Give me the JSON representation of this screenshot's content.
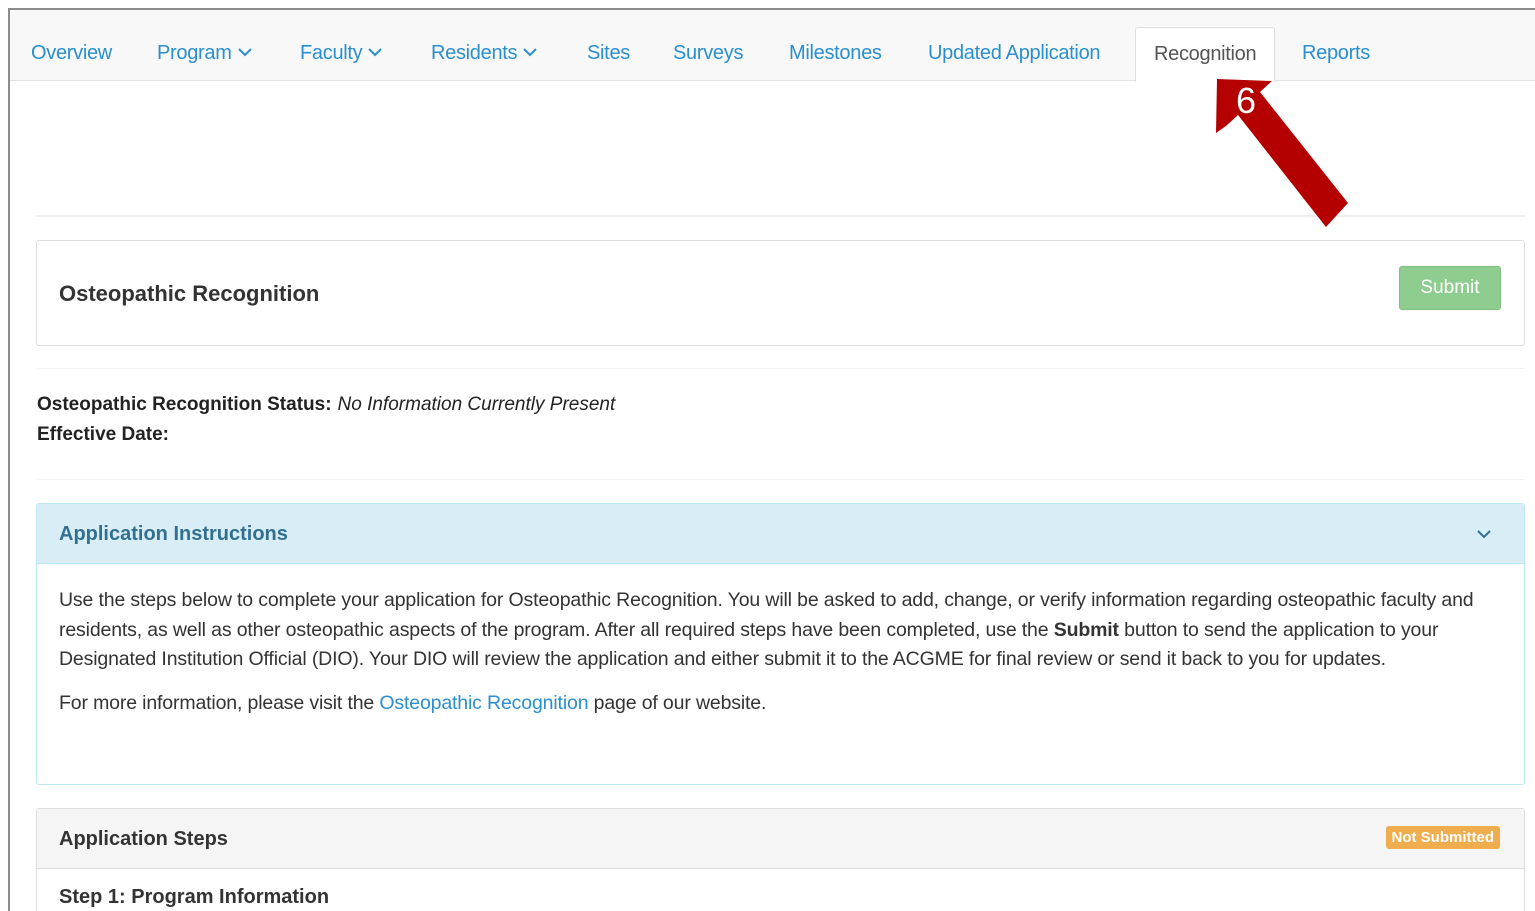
{
  "nav": {
    "items": [
      {
        "label": "Overview",
        "dropdown": false
      },
      {
        "label": "Program",
        "dropdown": true
      },
      {
        "label": "Faculty",
        "dropdown": true
      },
      {
        "label": "Residents",
        "dropdown": true
      },
      {
        "label": "Sites",
        "dropdown": false
      },
      {
        "label": "Surveys",
        "dropdown": false
      },
      {
        "label": "Milestones",
        "dropdown": false
      },
      {
        "label": "Updated Application",
        "dropdown": false
      },
      {
        "label": "Recognition",
        "dropdown": false,
        "active": true
      },
      {
        "label": "Reports",
        "dropdown": false
      }
    ]
  },
  "annotation": {
    "number": "6",
    "color": "#b50000"
  },
  "header": {
    "title": "Osteopathic Recognition",
    "submit_label": "Submit"
  },
  "status": {
    "status_label": "Osteopathic Recognition Status:",
    "status_value": "No Information Currently Present",
    "date_label": "Effective Date:"
  },
  "instructions": {
    "title": "Application Instructions",
    "para1_part1": "Use the steps below to complete your application for Osteopathic Recognition. You will be asked to add, change, or verify information regarding osteopathic faculty and residents, as well as other osteopathic aspects of the program. After all required steps have been completed, use the ",
    "para1_bold": "Submit",
    "para1_part2": " button to send the application to your Designated Institution Official (DIO). Your DIO will review the application and either submit it to the ACGME for final review or send it back to you for updates.",
    "para2_part1": "For more information, please visit the ",
    "para2_link": "Osteopathic Recognition",
    "para2_part2": " page of our website."
  },
  "steps": {
    "title": "Application Steps",
    "badge": "Not Submitted",
    "step1": "Step 1: Program Information"
  },
  "colors": {
    "link": "#2a8fcf",
    "submit_bg": "#8fcc8f",
    "badge_bg": "#f0ad4e",
    "info_bg": "#d9edf7"
  }
}
